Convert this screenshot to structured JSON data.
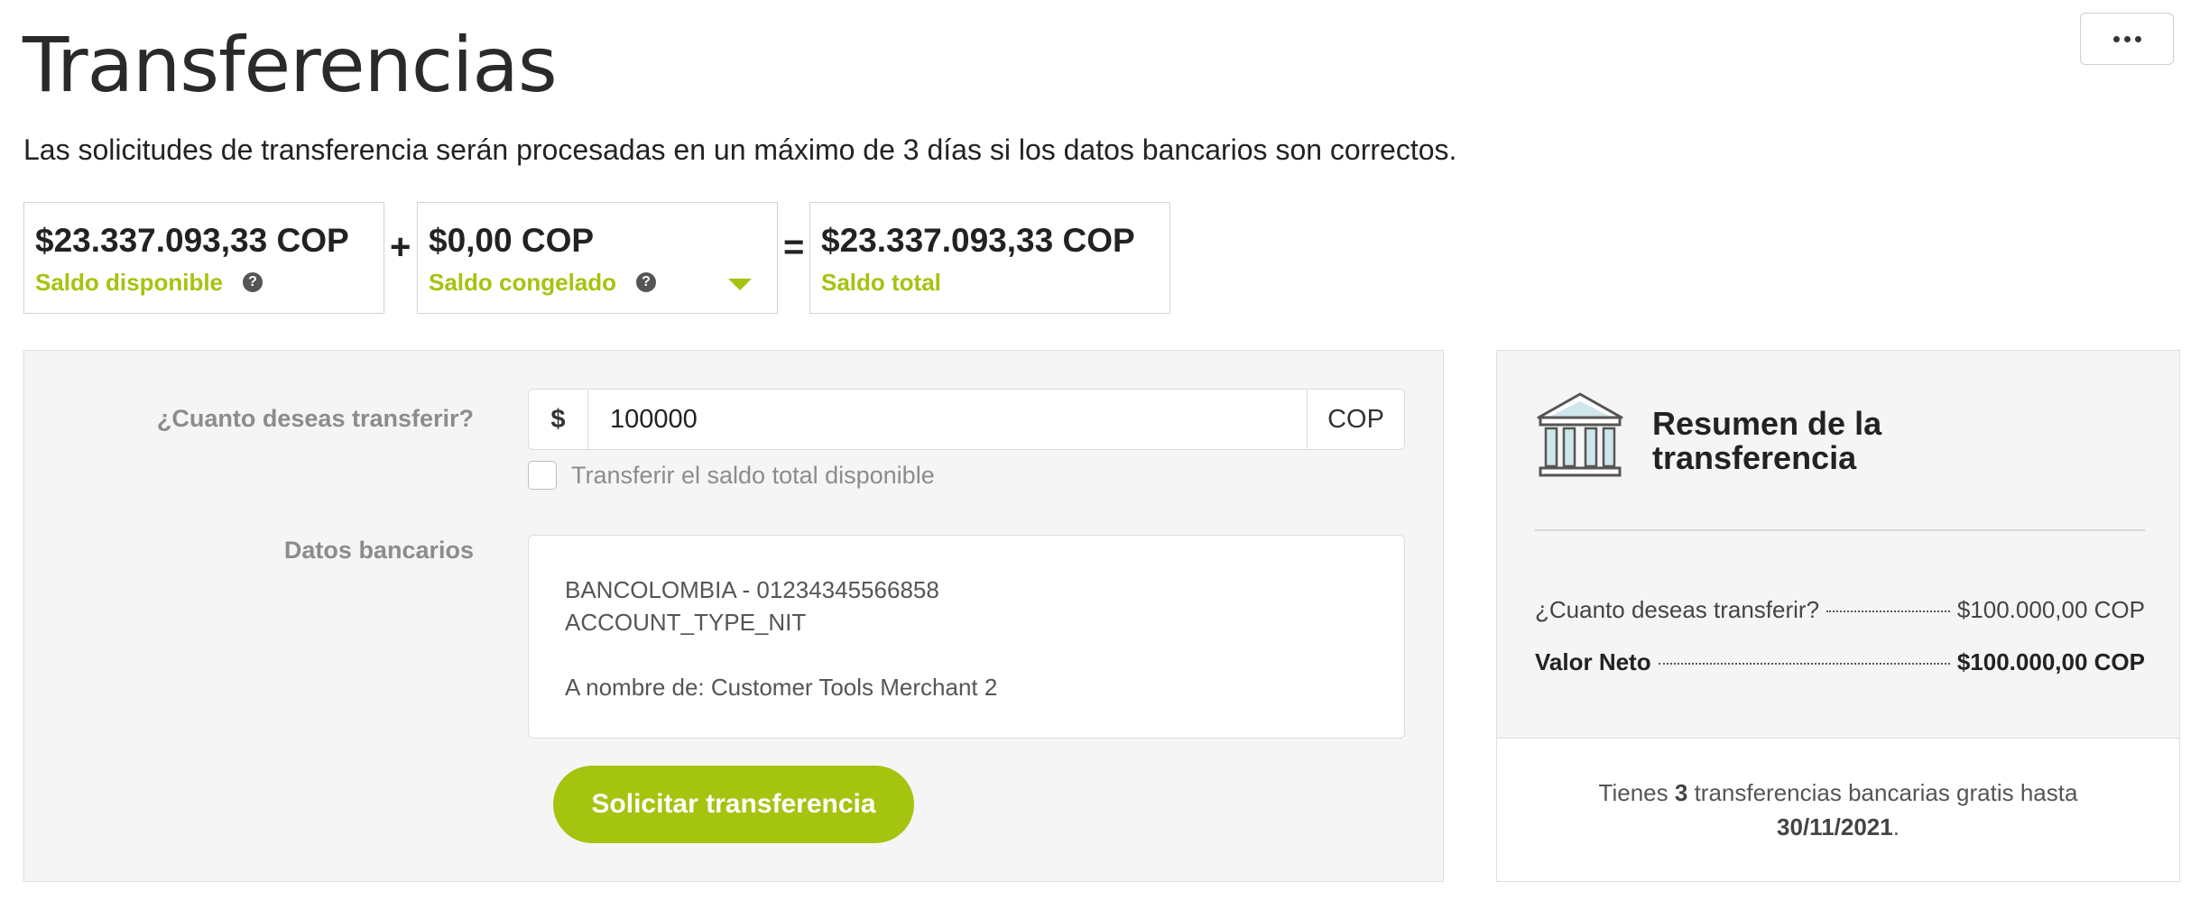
{
  "header": {
    "title": "Transferencias",
    "subtitle": "Las solicitudes de transferencia serán procesadas en un máximo de 3 días si los datos bancarios son correctos.",
    "more_icon": "ellipsis-icon"
  },
  "balances": {
    "available": {
      "amount": "$23.337.093,33 COP",
      "label": "Saldo disponible",
      "help": "?"
    },
    "frozen": {
      "amount": "$0,00 COP",
      "label": "Saldo congelado",
      "help": "?"
    },
    "total": {
      "amount": "$23.337.093,33 COP",
      "label": "Saldo total"
    },
    "plus": "+",
    "equals": "="
  },
  "form": {
    "amount_label": "¿Cuanto deseas transferir?",
    "currency_prefix": "$",
    "amount_value": "100000",
    "currency_suffix": "COP",
    "transfer_all_label": "Transferir el saldo total disponible",
    "transfer_all_checked": false,
    "bank_label": "Datos bancarios",
    "bank_line1": "BANCOLOMBIA - 01234345566858",
    "bank_line2": "ACCOUNT_TYPE_NIT",
    "bank_holder": "A nombre de: Customer Tools Merchant 2",
    "submit_label": "Solicitar transferencia"
  },
  "summary": {
    "title": "Resumen de la transferencia",
    "icon": "bank-icon",
    "amount_label": "¿Cuanto deseas transferir?",
    "amount_value": "$100.000,00 COP",
    "net_label": "Valor Neto",
    "net_value": "$100.000,00 COP",
    "free_prefix": "Tienes",
    "free_count": "3",
    "free_middle": "transferencias bancarias gratis hasta",
    "free_date": "30/11/2021",
    "free_suffix": "."
  },
  "colors": {
    "accent": "#a4c40f",
    "panel_bg": "#f5f5f5",
    "muted_label": "#8c8c8c"
  }
}
